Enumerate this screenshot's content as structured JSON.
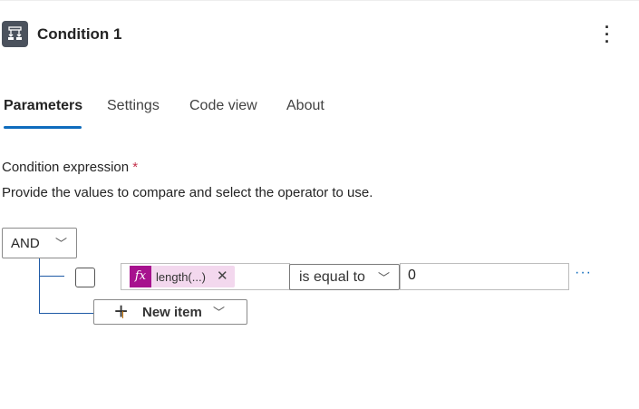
{
  "header": {
    "title": "Condition 1",
    "icon": "condition-icon",
    "menu_icon": "more-vertical-icon"
  },
  "tabs": [
    {
      "label": "Parameters",
      "active": true
    },
    {
      "label": "Settings"
    },
    {
      "label": "Code view"
    },
    {
      "label": "About"
    }
  ],
  "parameters": {
    "label": "Condition expression",
    "required_marker": "*",
    "description": "Provide the values to compare and select the operator to use.",
    "group_operator": "AND",
    "rows": [
      {
        "left_token": "length(...)",
        "token_icon": "fx",
        "operator": "is equal to",
        "right_value": "0",
        "more": "···"
      }
    ],
    "new_item_label": "New item"
  },
  "colors": {
    "accent": "#0f6cbd",
    "token": "#a7118e",
    "token_bg": "#f3d8ee"
  }
}
